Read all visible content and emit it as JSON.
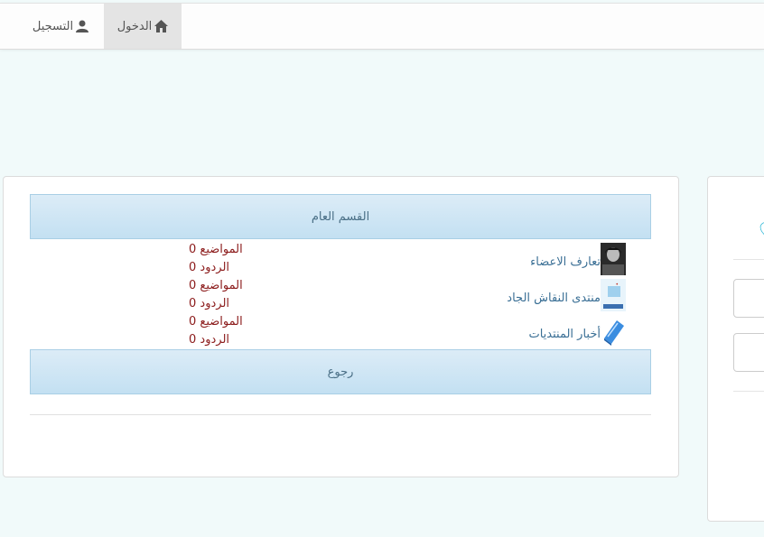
{
  "nav": {
    "login_label": "الدخول",
    "register_label": "التسجيل"
  },
  "category": {
    "title": "القسم العام"
  },
  "forums": [
    {
      "name": "تعارف الاعضاء",
      "topics": "المواضيع 0",
      "replies": "الردود 0",
      "icon": "member-avatar-icon"
    },
    {
      "name": "منتدى النقاش الجاد",
      "topics": "المواضيع 0",
      "replies": "الردود 0",
      "icon": "forum-logo-icon"
    },
    {
      "name": "أخبار المنتديات",
      "topics": "المواضيع 0",
      "replies": "الردود 0",
      "icon": "news-book-icon"
    }
  ],
  "back_label": "رجوع",
  "colors": {
    "accent": "#29b6d6",
    "link": "#3a6f95",
    "stats": "#8b1a1a",
    "header_bg": "#cfe6f5"
  }
}
